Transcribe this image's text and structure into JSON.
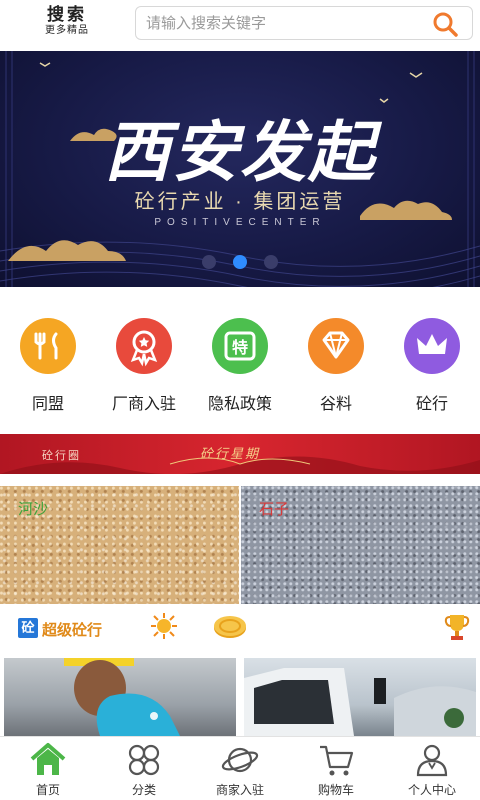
{
  "header": {
    "logo_title": "搜索",
    "logo_subtitle": "更多精品",
    "search_placeholder": "请输入搜索关键字",
    "search_icon": "search-icon",
    "accent": "#f07a2e"
  },
  "banner": {
    "title": "西安发起",
    "subtitle": "砼行产业 · 集团运营",
    "tagline": "POSITIVECENTER",
    "slides": 3,
    "active_slide": 2
  },
  "categories": [
    {
      "label": "同盟",
      "icon": "fork-knife-icon",
      "color": "#f5a623"
    },
    {
      "label": "厂商入驻",
      "icon": "award-ribbon-icon",
      "color": "#e84a3c"
    },
    {
      "label": "隐私政策",
      "icon": "special-tag-icon",
      "color": "#4cbf4e"
    },
    {
      "label": "谷料",
      "icon": "diamond-icon",
      "color": "#f48a2a"
    },
    {
      "label": "砼行",
      "icon": "crown-icon",
      "color": "#8f5be0"
    }
  ],
  "promo": {
    "small_text": "砼行圈",
    "center_text": "砼行星期"
  },
  "materials": [
    {
      "label": "河沙",
      "color": "#3ba33b"
    },
    {
      "label": "石子",
      "color": "#d83a3a"
    }
  ],
  "section": {
    "badge": "砼",
    "title": "超级砼行"
  },
  "nav": [
    {
      "label": "首页",
      "icon": "home-icon",
      "active": true
    },
    {
      "label": "分类",
      "icon": "category-icon",
      "active": false
    },
    {
      "label": "商家入驻",
      "icon": "planet-icon",
      "active": false
    },
    {
      "label": "购物车",
      "icon": "cart-icon",
      "active": false
    },
    {
      "label": "个人中心",
      "icon": "user-icon",
      "active": false
    }
  ]
}
